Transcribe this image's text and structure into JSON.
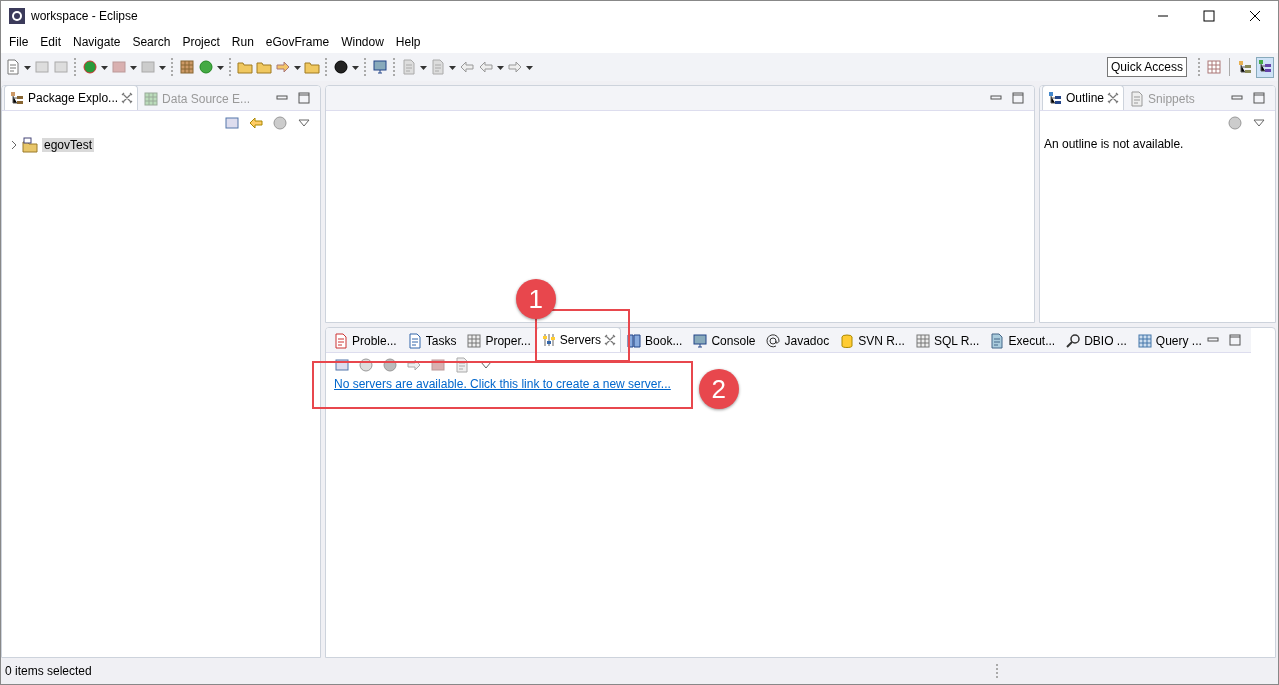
{
  "window": {
    "title": "workspace - Eclipse"
  },
  "menu": [
    "File",
    "Edit",
    "Navigate",
    "Search",
    "Project",
    "Run",
    "eGovFrame",
    "Window",
    "Help"
  ],
  "toolbar": {
    "quick_access": "Quick Access"
  },
  "package_explorer": {
    "tabs": [
      {
        "label": "Package Explo...",
        "selected": true
      },
      {
        "label": "Data Source E...",
        "selected": false
      }
    ],
    "tree": [
      {
        "label": "egovTest",
        "selected": true
      }
    ]
  },
  "outline": {
    "tabs": [
      {
        "label": "Outline",
        "selected": true
      },
      {
        "label": "Snippets",
        "selected": false
      }
    ],
    "message": "An outline is not available."
  },
  "bottom_panel": {
    "tabs": [
      {
        "label": "Proble...",
        "selected": false
      },
      {
        "label": "Tasks",
        "selected": false
      },
      {
        "label": "Proper...",
        "selected": false
      },
      {
        "label": "Servers",
        "selected": true
      },
      {
        "label": "Book...",
        "selected": false
      },
      {
        "label": "Console",
        "selected": false
      },
      {
        "label": "Javadoc",
        "selected": false
      },
      {
        "label": "SVN R...",
        "selected": false
      },
      {
        "label": "SQL R...",
        "selected": false
      },
      {
        "label": "Execut...",
        "selected": false
      },
      {
        "label": "DBIO ...",
        "selected": false
      },
      {
        "label": "Query ...",
        "selected": false
      }
    ],
    "link": "No servers are available. Click this link to create a new server..."
  },
  "callouts": [
    "1",
    "2"
  ],
  "status_bar": "0 items selected"
}
